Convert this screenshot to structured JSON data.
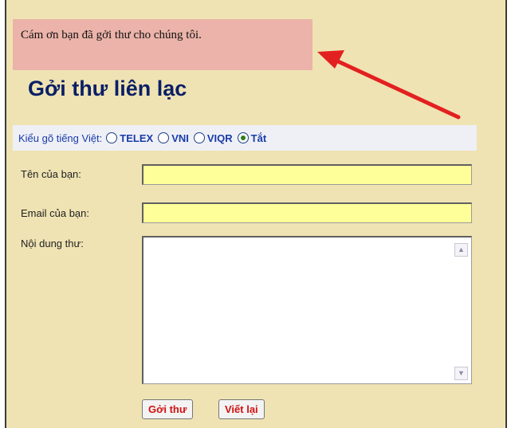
{
  "notice": {
    "text": "Cám ơn bạn đã gởi thư cho chúng tôi."
  },
  "form": {
    "title": "Gởi thư liên lạc",
    "keyboard": {
      "label": "Kiểu gõ tiếng Việt:",
      "options": [
        {
          "label": "TELEX",
          "selected": false
        },
        {
          "label": "VNI",
          "selected": false
        },
        {
          "label": "VIQR",
          "selected": false
        },
        {
          "label": "Tắt",
          "selected": true
        }
      ]
    },
    "name_label": "Tên của bạn:",
    "name_value": "",
    "email_label": "Email của bạn:",
    "email_value": "",
    "message_label": "Nội dung thư:",
    "message_value": "",
    "submit_label": "Gởi thư",
    "reset_label": "Viết lại"
  },
  "colors": {
    "panel": "#efe3b3",
    "notice": "#ebb3a9",
    "title": "#0b1f66",
    "input": "#ffff99",
    "arrow": "#e32020",
    "button_text": "#d21010"
  }
}
